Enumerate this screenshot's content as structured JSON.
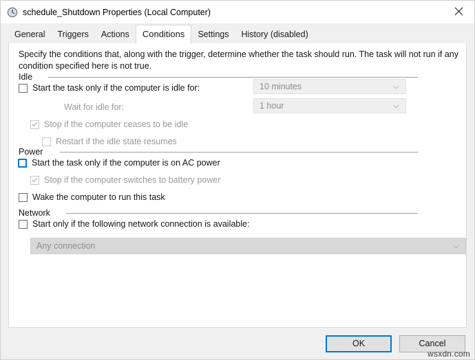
{
  "window": {
    "title": "schedule_Shutdown Properties (Local Computer)",
    "title_icon": "clock-icon",
    "close_label": "✕"
  },
  "tabs": [
    {
      "label": "General",
      "active": false
    },
    {
      "label": "Triggers",
      "active": false
    },
    {
      "label": "Actions",
      "active": false
    },
    {
      "label": "Conditions",
      "active": true
    },
    {
      "label": "Settings",
      "active": false
    },
    {
      "label": "History (disabled)",
      "active": false
    }
  ],
  "panel": {
    "description": "Specify the conditions that, along with the trigger, determine whether the task should run.  The task will not run  if any condition specified here is not true."
  },
  "groups": {
    "idle": {
      "label": "Idle",
      "start_idle_label": "Start the task only if the computer is idle for:",
      "wait_for_idle_label": "Wait for idle for:",
      "stop_ceases_idle_label": "Stop if the computer ceases to be idle",
      "restart_idle_label": "Restart if the idle state resumes",
      "idle_duration_value": "10 minutes",
      "wait_duration_value": "1 hour"
    },
    "power": {
      "label": "Power",
      "ac_power_label": "Start the task only if the computer is on AC power",
      "stop_battery_label": "Stop if the computer switches to battery power",
      "wake_computer_label": "Wake the computer to run this task"
    },
    "network": {
      "label": "Network",
      "network_connection_label": "Start only if the following network connection is available:",
      "connection_value": "Any connection"
    }
  },
  "footer": {
    "ok_label": "OK",
    "cancel_label": "Cancel"
  },
  "watermark": {
    "text": "wsxdn.com"
  },
  "colors": {
    "accent": "#0078d7",
    "disabled_text": "#999999",
    "text": "#161616"
  }
}
